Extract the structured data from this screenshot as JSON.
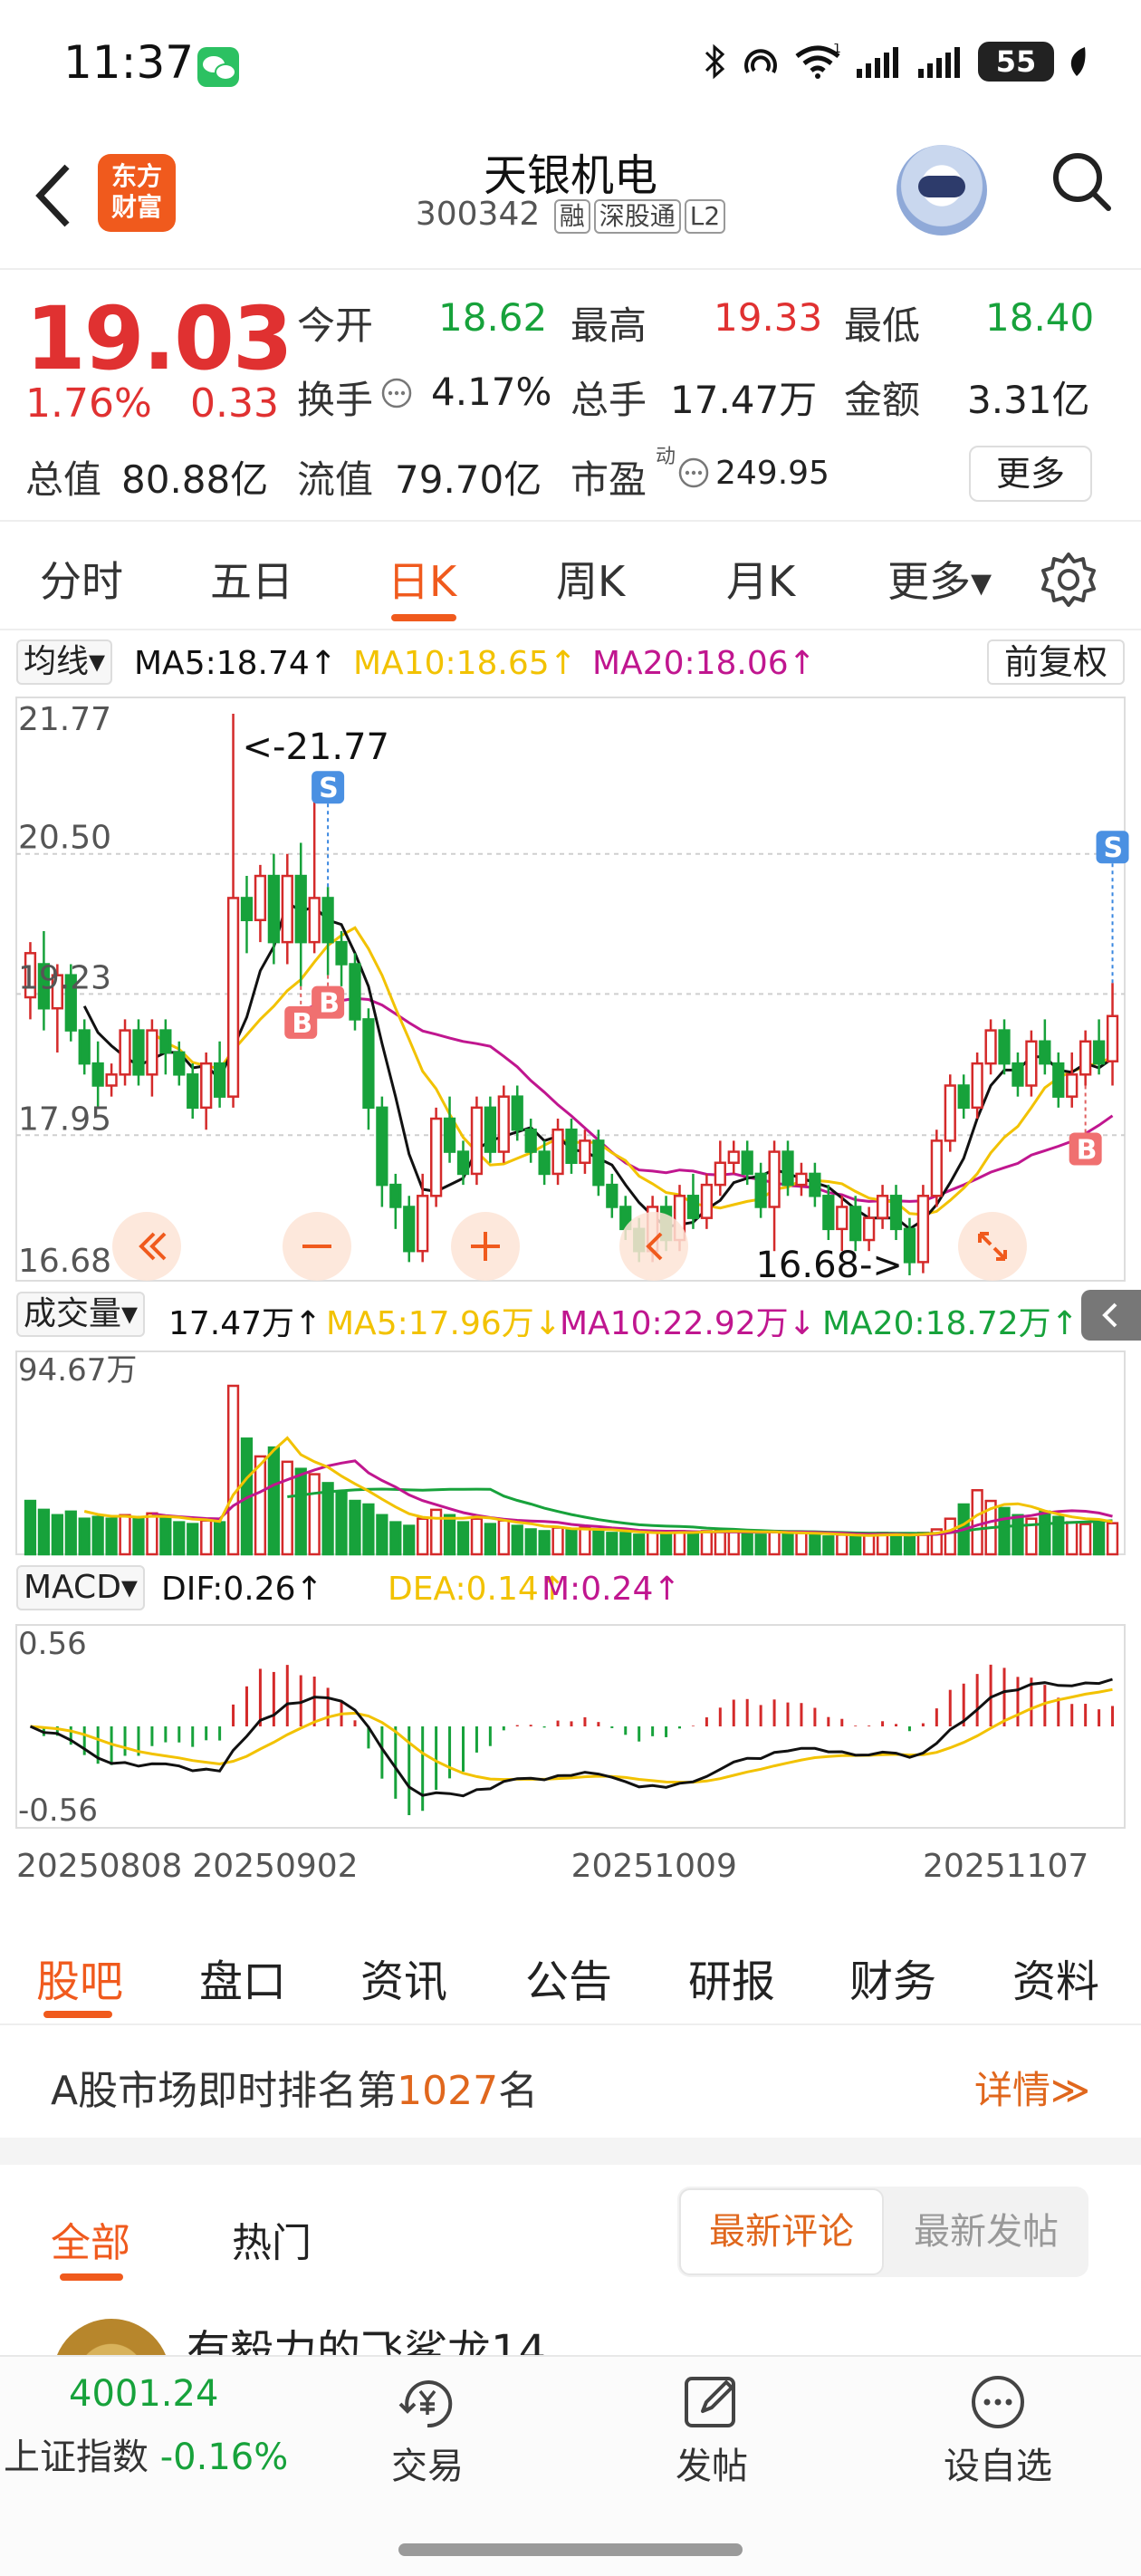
{
  "status_bar": {
    "time": "11:37",
    "wifi_badge": "1",
    "battery": "55"
  },
  "header": {
    "logo_line1": "东方",
    "logo_line2": "财富",
    "stock_name": "天银机电",
    "stock_code": "300342",
    "tags": [
      "融",
      "深股通",
      "L2"
    ],
    "icons": [
      "back-icon",
      "robot-avatar-icon",
      "search-icon"
    ]
  },
  "quote": {
    "price": "19.03",
    "change_pct": "1.76%",
    "change": "0.33",
    "open_label": "今开",
    "open": "18.62",
    "high_label": "最高",
    "high": "19.33",
    "low_label": "最低",
    "low": "18.40",
    "turnover_rate_label": "换手",
    "turnover_rate": "4.17%",
    "volume_label": "总手",
    "volume": "17.47万",
    "amount_label": "金额",
    "amount": "3.31亿",
    "total_cap_label": "总值",
    "total_cap": "80.88亿",
    "float_cap_label": "流值",
    "float_cap": "79.70亿",
    "pe_label": "市盈",
    "pe_super": "动",
    "pe": "249.95",
    "more_label": "更多"
  },
  "period_tabs": {
    "items": [
      "分时",
      "五日",
      "日K",
      "周K",
      "月K",
      "更多▾"
    ],
    "active": "日K"
  },
  "ma_legend": {
    "selector": "均线▾",
    "ma5": "MA5:18.74↑",
    "ma10": "MA10:18.65↑",
    "ma20": "MA20:18.06↑",
    "adjust": "前复权",
    "colors": {
      "ma5": "#111111",
      "ma10": "#f2c200",
      "ma20": "#c0168f"
    }
  },
  "vol_legend": {
    "selector": "成交量▾",
    "vol": "17.47万↑",
    "ma5": "MA5:17.96万↓",
    "ma10": "MA10:22.92万↓",
    "ma20": "MA20:18.72万↑",
    "colors": {
      "ma5": "#f2c200",
      "ma10": "#c0168f",
      "ma20": "#17a23b"
    }
  },
  "macd_legend": {
    "selector": "MACD▾",
    "dif": "DIF:0.26↑",
    "dea": "DEA:0.14↑",
    "m": "M:0.24↑",
    "colors": {
      "dif": "#111111",
      "dea": "#f2c200",
      "m": "#c0168f"
    }
  },
  "chart_data": [
    {
      "type": "candlestick",
      "title": "",
      "y_ticks": [
        "21.77",
        "20.50",
        "19.23",
        "17.95",
        "16.68"
      ],
      "ylim": [
        16.68,
        21.77
      ],
      "annotations": {
        "max": "<-21.77",
        "min": "16.68->"
      },
      "trade_markers": [
        "S",
        "B",
        "B",
        "S",
        "B"
      ],
      "x_ticks": [
        "20250808",
        "20250902",
        "20251009",
        "20251107"
      ],
      "candles": [
        [
          19.2,
          19.6,
          19.0,
          19.7
        ],
        [
          19.5,
          19.1,
          18.9,
          19.8
        ],
        [
          19.1,
          19.4,
          18.7,
          19.5
        ],
        [
          19.4,
          18.9,
          18.8,
          19.5
        ],
        [
          18.9,
          18.6,
          18.5,
          19.0
        ],
        [
          18.6,
          18.4,
          18.2,
          18.8
        ],
        [
          18.4,
          18.5,
          18.3,
          18.6
        ],
        [
          18.5,
          18.9,
          18.4,
          19.0
        ],
        [
          18.9,
          18.5,
          18.4,
          19.0
        ],
        [
          18.5,
          18.9,
          18.3,
          19.0
        ],
        [
          18.9,
          18.7,
          18.5,
          19.0
        ],
        [
          18.7,
          18.5,
          18.4,
          18.8
        ],
        [
          18.5,
          18.2,
          18.1,
          18.6
        ],
        [
          18.2,
          18.6,
          18.0,
          18.7
        ],
        [
          18.6,
          18.3,
          18.2,
          18.8
        ],
        [
          18.3,
          20.1,
          18.2,
          21.77
        ],
        [
          20.1,
          19.9,
          19.6,
          20.3
        ],
        [
          19.9,
          20.3,
          19.7,
          20.4
        ],
        [
          20.3,
          19.7,
          19.5,
          20.5
        ],
        [
          19.7,
          20.3,
          19.5,
          20.5
        ],
        [
          20.3,
          19.7,
          19.3,
          20.6
        ],
        [
          19.7,
          20.1,
          19.6,
          21.1
        ],
        [
          20.1,
          19.7,
          19.4,
          20.2
        ],
        [
          19.7,
          19.5,
          19.3,
          19.8
        ],
        [
          19.5,
          19.0,
          18.9,
          19.6
        ],
        [
          19.0,
          18.2,
          18.0,
          19.1
        ],
        [
          18.2,
          17.5,
          17.3,
          18.3
        ],
        [
          17.5,
          17.3,
          17.1,
          17.6
        ],
        [
          17.3,
          16.9,
          16.8,
          17.4
        ],
        [
          16.9,
          17.4,
          16.8,
          17.6
        ],
        [
          17.4,
          18.1,
          17.3,
          18.2
        ],
        [
          18.1,
          17.8,
          17.7,
          18.3
        ],
        [
          17.8,
          17.6,
          17.5,
          17.9
        ],
        [
          17.6,
          18.2,
          17.5,
          18.3
        ],
        [
          18.2,
          17.8,
          17.7,
          18.3
        ],
        [
          17.8,
          18.3,
          17.7,
          18.4
        ],
        [
          18.3,
          18.0,
          17.9,
          18.4
        ],
        [
          18.0,
          17.8,
          17.7,
          18.1
        ],
        [
          17.8,
          17.6,
          17.5,
          17.9
        ],
        [
          17.6,
          18.0,
          17.5,
          18.1
        ],
        [
          18.0,
          17.7,
          17.6,
          18.1
        ],
        [
          17.7,
          17.9,
          17.6,
          18.0
        ],
        [
          17.9,
          17.5,
          17.4,
          18.0
        ],
        [
          17.5,
          17.3,
          17.2,
          17.6
        ],
        [
          17.3,
          17.1,
          17.0,
          17.4
        ],
        [
          17.1,
          16.9,
          16.8,
          17.2
        ],
        [
          16.9,
          17.3,
          16.8,
          17.4
        ],
        [
          17.3,
          17.0,
          16.9,
          17.4
        ],
        [
          17.0,
          17.4,
          16.9,
          17.5
        ],
        [
          17.4,
          17.2,
          17.1,
          17.6
        ],
        [
          17.2,
          17.5,
          17.1,
          17.6
        ],
        [
          17.5,
          17.7,
          17.4,
          17.9
        ],
        [
          17.7,
          17.8,
          17.6,
          17.9
        ],
        [
          17.8,
          17.6,
          17.5,
          17.9
        ],
        [
          17.6,
          17.3,
          17.2,
          17.7
        ],
        [
          17.3,
          17.8,
          16.9,
          17.9
        ],
        [
          17.8,
          17.5,
          17.4,
          17.9
        ],
        [
          17.5,
          17.6,
          17.4,
          17.7
        ],
        [
          17.6,
          17.4,
          17.3,
          17.7
        ],
        [
          17.4,
          17.1,
          17.0,
          17.5
        ],
        [
          17.1,
          17.3,
          16.9,
          17.4
        ],
        [
          17.3,
          17.0,
          16.9,
          17.4
        ],
        [
          17.0,
          17.2,
          16.9,
          17.3
        ],
        [
          17.2,
          17.4,
          17.1,
          17.5
        ],
        [
          17.4,
          17.1,
          17.0,
          17.5
        ],
        [
          17.1,
          16.8,
          16.68,
          17.2
        ],
        [
          16.8,
          17.4,
          16.7,
          17.5
        ],
        [
          17.4,
          17.9,
          17.3,
          18.0
        ],
        [
          17.9,
          18.4,
          17.8,
          18.5
        ],
        [
          18.4,
          18.2,
          18.1,
          18.5
        ],
        [
          18.2,
          18.6,
          18.1,
          18.7
        ],
        [
          18.6,
          18.9,
          18.5,
          19.0
        ],
        [
          18.9,
          18.6,
          18.5,
          19.0
        ],
        [
          18.6,
          18.4,
          18.3,
          18.7
        ],
        [
          18.4,
          18.8,
          18.3,
          18.9
        ],
        [
          18.8,
          18.6,
          18.5,
          19.0
        ],
        [
          18.6,
          18.3,
          18.2,
          18.7
        ],
        [
          18.3,
          18.5,
          18.2,
          18.7
        ],
        [
          18.5,
          18.8,
          18.4,
          18.9
        ],
        [
          18.8,
          18.6,
          18.5,
          19.0
        ],
        [
          18.62,
          19.03,
          18.4,
          19.33
        ]
      ]
    },
    {
      "type": "bar",
      "title": "",
      "y_ticks": [
        "94.67万"
      ],
      "ylim": [
        0,
        94.67
      ],
      "values": [
        30,
        25,
        22,
        24,
        20,
        21,
        20,
        22,
        21,
        23,
        20,
        18,
        17,
        19,
        18,
        94.67,
        65,
        55,
        60,
        52,
        48,
        45,
        40,
        35,
        30,
        28,
        22,
        18,
        16,
        20,
        25,
        22,
        18,
        20,
        17,
        19,
        16,
        14,
        13,
        15,
        14,
        15,
        13,
        12,
        12,
        11,
        13,
        12,
        13,
        12,
        13,
        14,
        13,
        12,
        11,
        13,
        12,
        12,
        11,
        10,
        11,
        10,
        11,
        12,
        11,
        10,
        12,
        14,
        20,
        28,
        36,
        30,
        26,
        22,
        20,
        24,
        21,
        18,
        17,
        18,
        17.47
      ],
      "up": [
        0,
        0,
        0,
        0,
        0,
        0,
        0,
        1,
        0,
        1,
        0,
        0,
        0,
        1,
        0,
        1,
        0,
        1,
        0,
        1,
        0,
        1,
        0,
        0,
        0,
        0,
        0,
        0,
        0,
        1,
        1,
        0,
        0,
        1,
        0,
        1,
        0,
        0,
        0,
        1,
        0,
        1,
        0,
        0,
        0,
        0,
        1,
        0,
        1,
        0,
        1,
        1,
        1,
        0,
        0,
        1,
        0,
        1,
        0,
        0,
        1,
        0,
        1,
        1,
        0,
        0,
        1,
        1,
        1,
        0,
        1,
        1,
        0,
        0,
        1,
        0,
        0,
        1,
        1,
        0,
        1
      ]
    },
    {
      "type": "bar",
      "title": "",
      "y_ticks": [
        "0.56",
        "-0.56"
      ],
      "ylim": [
        -0.56,
        0.56
      ]
    }
  ],
  "chart_buttons": [
    "double-left-icon",
    "zoom-out-icon",
    "zoom-in-icon",
    "left-icon",
    "expand-icon"
  ],
  "bottom_tabs": {
    "items": [
      "股吧",
      "盘口",
      "资讯",
      "公告",
      "研报",
      "财务",
      "资料"
    ],
    "active": "股吧"
  },
  "ranking": {
    "prefix": "A股市场即时排名第",
    "number": "1027",
    "suffix": "名",
    "detail": "详情≫"
  },
  "feed_tabs": {
    "items": [
      "全部",
      "热门"
    ],
    "active": "全部",
    "sort_on": "最新评论",
    "sort_off": "最新发帖"
  },
  "post_peek": "有毅力的飞鲨龙14",
  "bottom_nav": {
    "index_value": "4001.24",
    "index_name": "上证指数",
    "index_change": "-0.16%",
    "items": [
      "交易",
      "发帖",
      "设自选"
    ]
  }
}
